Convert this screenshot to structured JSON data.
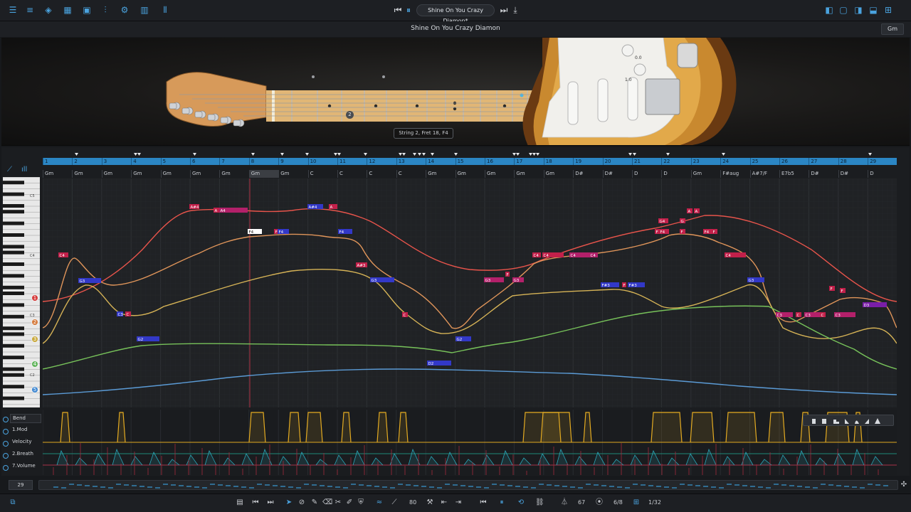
{
  "window": {
    "song_pill": "Shine On You Crazy Diamon*",
    "title": "Shine On You Crazy Diamon",
    "key": "Gm"
  },
  "instrument": {
    "tooltip": "String 2, Fret 18, F4",
    "page": "2",
    "knob_labels": [
      "0.0",
      "1.0"
    ]
  },
  "bars": [
    "1",
    "2",
    "3",
    "4",
    "5",
    "6",
    "7",
    "8",
    "9",
    "10",
    "11",
    "12",
    "13",
    "14",
    "15",
    "16",
    "17",
    "18",
    "19",
    "20",
    "21",
    "22",
    "23",
    "24",
    "25",
    "26",
    "27",
    "28",
    "29"
  ],
  "chords": [
    "Gm",
    "Gm",
    "Gm",
    "Gm",
    "Gm",
    "Gm",
    "Gm",
    "Gm",
    "Gm",
    "C",
    "C",
    "C",
    "C",
    "Gm",
    "Gm",
    "Gm",
    "Gm",
    "Gm",
    "D#",
    "D#",
    "D",
    "D",
    "Gm",
    "F#aug",
    "A#7/F",
    "E7b5",
    "D#",
    "D#",
    "D"
  ],
  "piano_labels": [
    "C5",
    "C4",
    "C3",
    "C2"
  ],
  "string_badges": [
    "1",
    "2",
    "3",
    "4",
    "5"
  ],
  "notes": [
    "C4",
    "G3",
    "C3",
    "C",
    "G2",
    "A#4",
    "A",
    "A4",
    "A#4",
    "A",
    "F4",
    "F",
    "F4",
    "F4",
    "A#3",
    "G3",
    "C",
    "D2",
    "G2",
    "G3",
    "F",
    "G3",
    "C4",
    "C4",
    "C4",
    "C4",
    "F#3",
    "F",
    "F#3",
    "G4",
    "G",
    "A",
    "A",
    "F",
    "F4",
    "F",
    "F4",
    "F",
    "F",
    "C4",
    "G3",
    "C3",
    "C",
    "C3",
    "C",
    "C3",
    "F",
    "D3"
  ],
  "lanes": [
    "Bend",
    "1.Mod",
    "Velocity",
    "2.Breath",
    "7.Volume"
  ],
  "transport": {
    "bar": "29",
    "quantize_value": "80",
    "tempo": "67",
    "time_signature": "6/8",
    "grid": "1/32"
  }
}
